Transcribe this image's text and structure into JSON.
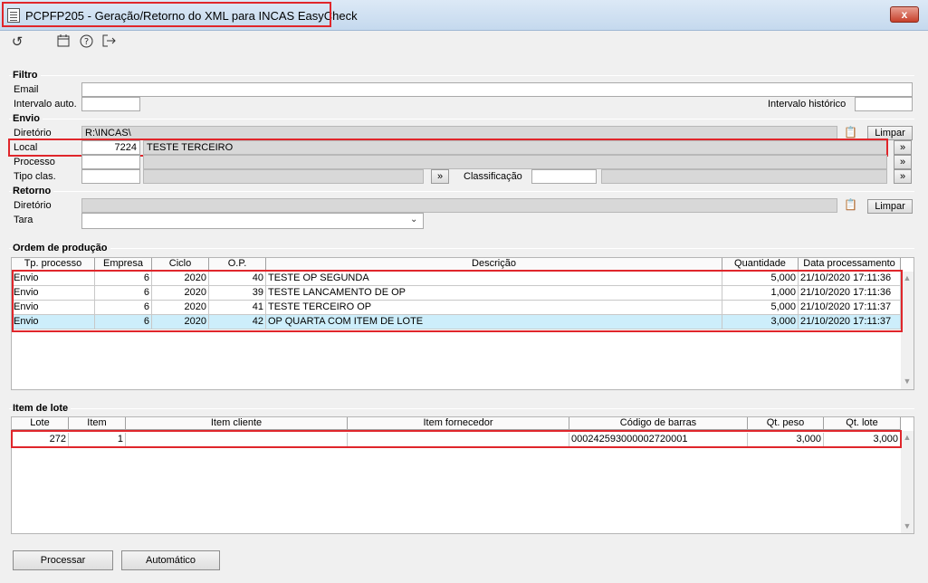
{
  "window": {
    "title": "PCPFP205 - Geração/Retorno do XML para INCAS EasyCheck",
    "close": "x"
  },
  "toolbar": {
    "icons": [
      "refresh-icon",
      "calendar-icon",
      "help-icon",
      "exit-icon"
    ]
  },
  "filtro": {
    "title": "Filtro",
    "email_label": "Email",
    "email_value": "",
    "intervalo_auto_label": "Intervalo auto.",
    "intervalo_auto_value": "",
    "intervalo_hist_label": "Intervalo histórico",
    "intervalo_hist_value": ""
  },
  "envio": {
    "title": "Envio",
    "diretorio_label": "Diretório",
    "diretorio_value": "R:\\INCAS\\",
    "limpar": "Limpar",
    "local_label": "Local",
    "local_code": "7224",
    "local_desc": "TESTE TERCEIRO",
    "processo_label": "Processo",
    "tipo_clas_label": "Tipo clas.",
    "classificacao_label": "Classificação",
    "more": "»"
  },
  "retorno": {
    "title": "Retorno",
    "diretorio_label": "Diretório",
    "diretorio_value": "",
    "limpar": "Limpar",
    "tara_label": "Tara",
    "tara_value": ""
  },
  "ordem": {
    "title": "Ordem de produção",
    "headers": [
      "Tp. processo",
      "Empresa",
      "Ciclo",
      "O.P.",
      "Descrição",
      "Quantidade",
      "Data processamento"
    ],
    "rows": [
      [
        "Envio",
        "6",
        "2020",
        "40",
        "TESTE OP SEGUNDA",
        "5,000",
        "21/10/2020 17:11:36"
      ],
      [
        "Envio",
        "6",
        "2020",
        "39",
        "TESTE LANCAMENTO DE OP",
        "1,000",
        "21/10/2020 17:11:36"
      ],
      [
        "Envio",
        "6",
        "2020",
        "41",
        "TESTE TERCEIRO OP",
        "5,000",
        "21/10/2020 17:11:37"
      ],
      [
        "Envio",
        "6",
        "2020",
        "42",
        "OP QUARTA COM ITEM DE LOTE",
        "3,000",
        "21/10/2020 17:11:37"
      ]
    ]
  },
  "lote": {
    "title": "Item de lote",
    "headers": [
      "Lote",
      "Item",
      "Item cliente",
      "Item fornecedor",
      "Código de barras",
      "Qt. peso",
      "Qt. lote"
    ],
    "rows": [
      [
        "272",
        "1",
        "",
        "",
        "000242593000002720001",
        "3,000",
        "3,000"
      ]
    ]
  },
  "buttons": {
    "processar": "Processar",
    "automatico": "Automático"
  }
}
